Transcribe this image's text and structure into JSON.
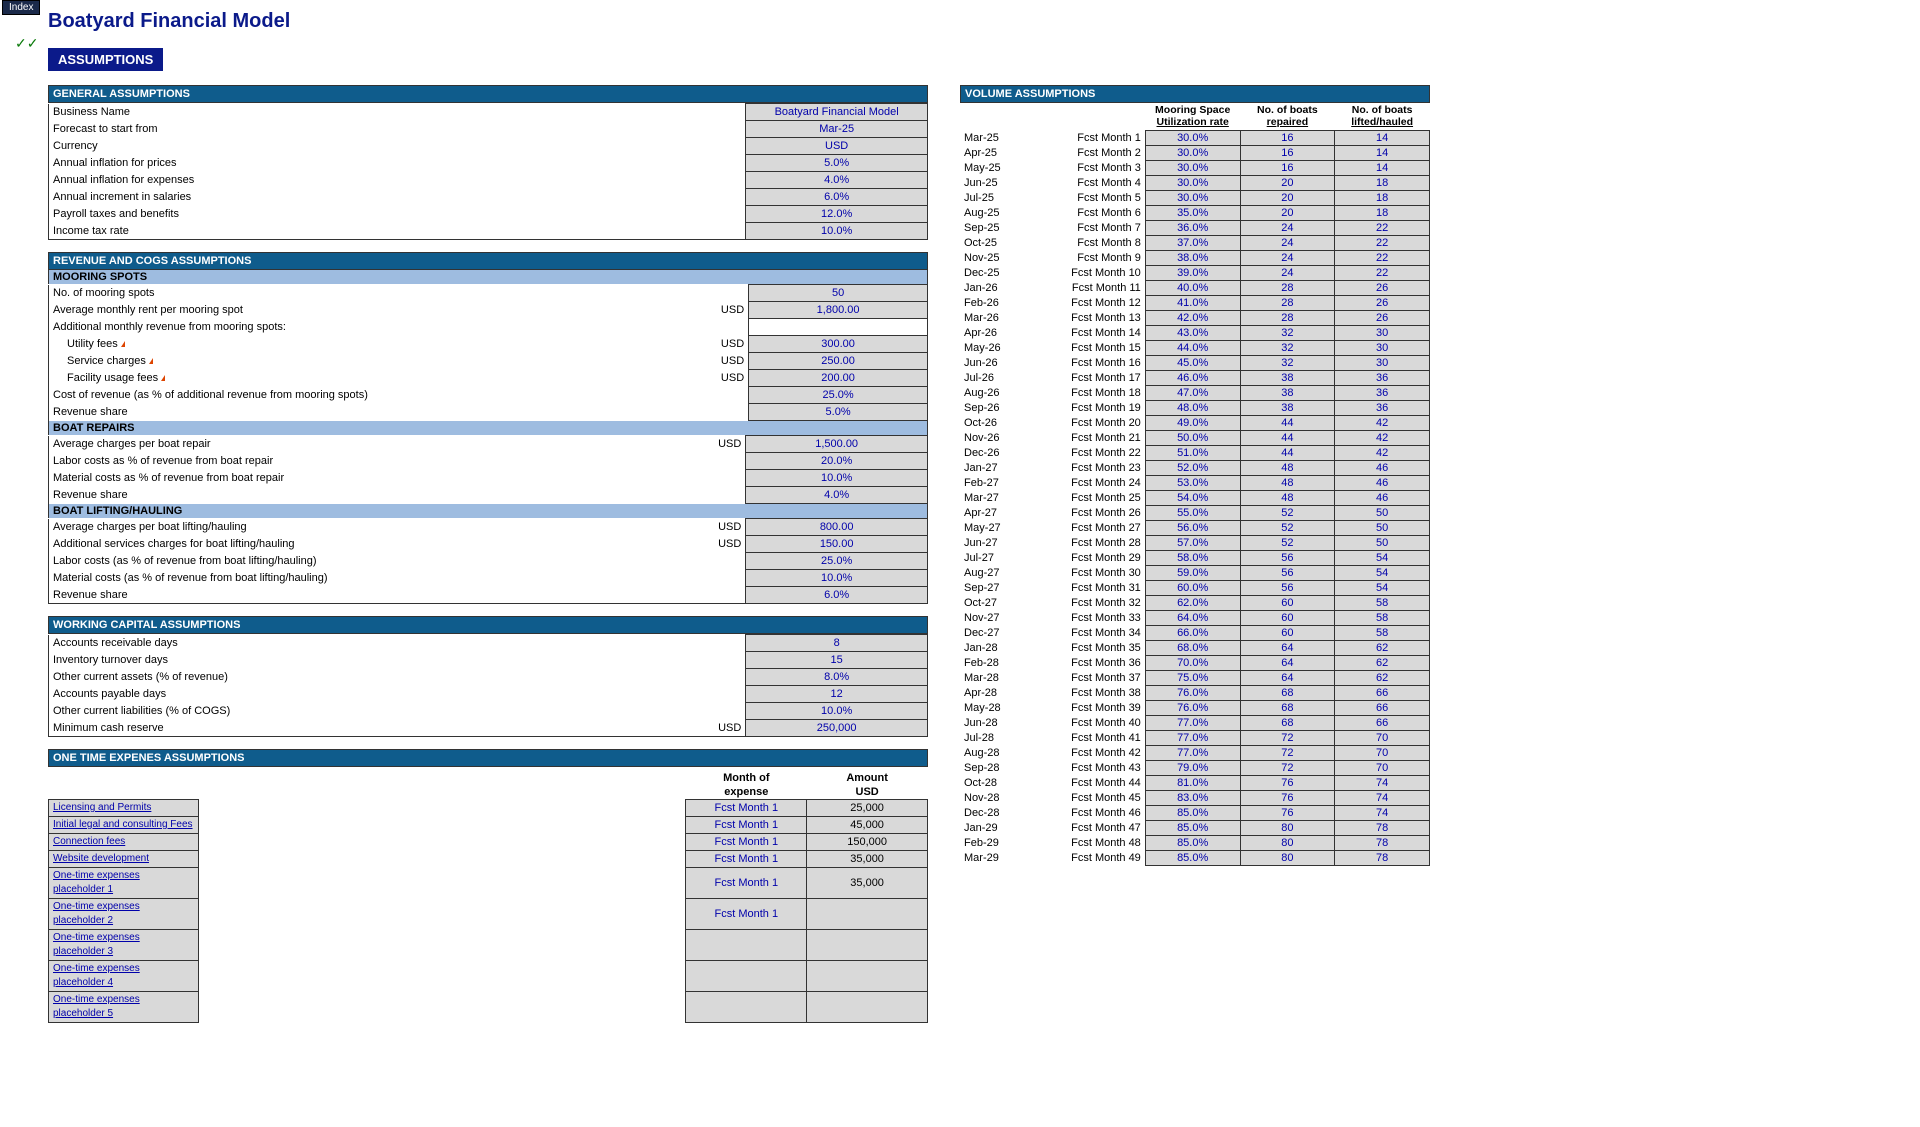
{
  "ui": {
    "index_tab": "Index",
    "title": "Boatyard Financial Model",
    "assumptions_badge": "ASSUMPTIONS",
    "checkmarks": "✓✓"
  },
  "sections": {
    "general": "GENERAL ASSUMPTIONS",
    "revcogs": "REVENUE AND COGS ASSUMPTIONS",
    "mooring": "MOORING SPOTS",
    "repairs": "BOAT REPAIRS",
    "lifting": "BOAT LIFTING/HAULING",
    "wc": "WORKING CAPITAL ASSUMPTIONS",
    "ote": "ONE TIME EXPENES ASSUMPTIONS",
    "volume": "VOLUME ASSUMPTIONS"
  },
  "labels": {
    "business_name": "Business Name",
    "forecast_start": "Forecast to start from",
    "currency": "Currency",
    "infl_prices": "Annual inflation for prices",
    "infl_expenses": "Annual inflation for expenses",
    "incr_salaries": "Annual increment in salaries",
    "payroll_tax": "Payroll taxes and benefits",
    "income_tax": "Income tax rate",
    "no_mooring": "No. of mooring spots",
    "avg_rent": "Average monthly rent per mooring spot",
    "addl_rev": "Additional monthly revenue from mooring spots:",
    "utility": "Utility fees",
    "service": "Service charges",
    "facility": "Facility usage fees",
    "cost_rev_pct": "Cost of revenue (as % of additional revenue from mooring spots)",
    "rev_share": "Revenue share",
    "avg_repair": "Average charges per boat repair",
    "labor_repair": "Labor costs as % of revenue from boat repair",
    "mat_repair": "Material costs as % of revenue from boat repair",
    "avg_lift": "Average charges per boat lifting/hauling",
    "addl_lift": "Additional services charges for boat lifting/hauling",
    "labor_lift": "Labor costs (as % of revenue from boat lifting/hauling)",
    "mat_lift": "Material costs (as % of revenue from boat lifting/hauling)",
    "ar_days": "Accounts receivable days",
    "inv_days": "Inventory turnover days",
    "oca_pct": "Other current assets (% of revenue)",
    "ap_days": "Accounts payable days",
    "ocl_pct": "Other current liabilities (% of COGS)",
    "min_cash": "Minimum cash reserve",
    "ote_month_hdr1": "Month of",
    "ote_month_hdr2": "expense",
    "ote_amt_hdr1": "Amount",
    "ote_amt_hdr2": "USD",
    "vol_h1a": "Mooring Space",
    "vol_h1b": "Utilization rate",
    "vol_h2a": "No. of boats",
    "vol_h2b": "repaired",
    "vol_h3a": "No. of boats",
    "vol_h3b": "lifted/hauled"
  },
  "usd": "USD",
  "general": {
    "business_name": "Boatyard Financial Model",
    "forecast_start": "Mar-25",
    "currency": "USD",
    "infl_prices": "5.0%",
    "infl_expenses": "4.0%",
    "incr_salaries": "6.0%",
    "payroll_tax": "12.0%",
    "income_tax": "10.0%"
  },
  "mooring": {
    "no_spots": "50",
    "avg_rent": "1,800.00",
    "utility": "300.00",
    "service": "250.00",
    "facility": "200.00",
    "cost_rev_pct": "25.0%",
    "rev_share": "5.0%"
  },
  "repairs": {
    "avg_charge": "1,500.00",
    "labor_pct": "20.0%",
    "mat_pct": "10.0%",
    "rev_share": "4.0%"
  },
  "lifting": {
    "avg_charge": "800.00",
    "addl_charge": "150.00",
    "labor_pct": "25.0%",
    "mat_pct": "10.0%",
    "rev_share": "6.0%"
  },
  "wc": {
    "ar_days": "8",
    "inv_days": "15",
    "oca_pct": "8.0%",
    "ap_days": "12",
    "ocl_pct": "10.0%",
    "min_cash": "250,000"
  },
  "ote": [
    {
      "name": "Licensing and Permits",
      "month": "Fcst Month 1",
      "amt": "25,000"
    },
    {
      "name": "Initial legal and consulting Fees",
      "month": "Fcst Month 1",
      "amt": "45,000"
    },
    {
      "name": "Connection fees",
      "month": "Fcst Month 1",
      "amt": "150,000"
    },
    {
      "name": "Website development",
      "month": "Fcst Month 1",
      "amt": "35,000"
    },
    {
      "name": "One-time expenses placeholder 1",
      "month": "Fcst Month 1",
      "amt": "35,000"
    },
    {
      "name": "One-time expenses placeholder 2",
      "month": "Fcst Month 1",
      "amt": ""
    },
    {
      "name": "One-time expenses placeholder 3",
      "month": "",
      "amt": ""
    },
    {
      "name": "One-time expenses placeholder 4",
      "month": "",
      "amt": ""
    },
    {
      "name": "One-time expenses placeholder 5",
      "month": "",
      "amt": ""
    }
  ],
  "volume": [
    {
      "m": "Mar-25",
      "n": "Fcst Month 1",
      "u": "30.0%",
      "r": "16",
      "l": "14"
    },
    {
      "m": "Apr-25",
      "n": "Fcst Month 2",
      "u": "30.0%",
      "r": "16",
      "l": "14"
    },
    {
      "m": "May-25",
      "n": "Fcst Month 3",
      "u": "30.0%",
      "r": "16",
      "l": "14"
    },
    {
      "m": "Jun-25",
      "n": "Fcst Month 4",
      "u": "30.0%",
      "r": "20",
      "l": "18"
    },
    {
      "m": "Jul-25",
      "n": "Fcst Month 5",
      "u": "30.0%",
      "r": "20",
      "l": "18"
    },
    {
      "m": "Aug-25",
      "n": "Fcst Month 6",
      "u": "35.0%",
      "r": "20",
      "l": "18"
    },
    {
      "m": "Sep-25",
      "n": "Fcst Month 7",
      "u": "36.0%",
      "r": "24",
      "l": "22"
    },
    {
      "m": "Oct-25",
      "n": "Fcst Month 8",
      "u": "37.0%",
      "r": "24",
      "l": "22"
    },
    {
      "m": "Nov-25",
      "n": "Fcst Month 9",
      "u": "38.0%",
      "r": "24",
      "l": "22"
    },
    {
      "m": "Dec-25",
      "n": "Fcst Month 10",
      "u": "39.0%",
      "r": "24",
      "l": "22"
    },
    {
      "m": "Jan-26",
      "n": "Fcst Month 11",
      "u": "40.0%",
      "r": "28",
      "l": "26"
    },
    {
      "m": "Feb-26",
      "n": "Fcst Month 12",
      "u": "41.0%",
      "r": "28",
      "l": "26"
    },
    {
      "m": "Mar-26",
      "n": "Fcst Month 13",
      "u": "42.0%",
      "r": "28",
      "l": "26"
    },
    {
      "m": "Apr-26",
      "n": "Fcst Month 14",
      "u": "43.0%",
      "r": "32",
      "l": "30"
    },
    {
      "m": "May-26",
      "n": "Fcst Month 15",
      "u": "44.0%",
      "r": "32",
      "l": "30"
    },
    {
      "m": "Jun-26",
      "n": "Fcst Month 16",
      "u": "45.0%",
      "r": "32",
      "l": "30"
    },
    {
      "m": "Jul-26",
      "n": "Fcst Month 17",
      "u": "46.0%",
      "r": "38",
      "l": "36"
    },
    {
      "m": "Aug-26",
      "n": "Fcst Month 18",
      "u": "47.0%",
      "r": "38",
      "l": "36"
    },
    {
      "m": "Sep-26",
      "n": "Fcst Month 19",
      "u": "48.0%",
      "r": "38",
      "l": "36"
    },
    {
      "m": "Oct-26",
      "n": "Fcst Month 20",
      "u": "49.0%",
      "r": "44",
      "l": "42"
    },
    {
      "m": "Nov-26",
      "n": "Fcst Month 21",
      "u": "50.0%",
      "r": "44",
      "l": "42"
    },
    {
      "m": "Dec-26",
      "n": "Fcst Month 22",
      "u": "51.0%",
      "r": "44",
      "l": "42"
    },
    {
      "m": "Jan-27",
      "n": "Fcst Month 23",
      "u": "52.0%",
      "r": "48",
      "l": "46"
    },
    {
      "m": "Feb-27",
      "n": "Fcst Month 24",
      "u": "53.0%",
      "r": "48",
      "l": "46"
    },
    {
      "m": "Mar-27",
      "n": "Fcst Month 25",
      "u": "54.0%",
      "r": "48",
      "l": "46"
    },
    {
      "m": "Apr-27",
      "n": "Fcst Month 26",
      "u": "55.0%",
      "r": "52",
      "l": "50"
    },
    {
      "m": "May-27",
      "n": "Fcst Month 27",
      "u": "56.0%",
      "r": "52",
      "l": "50"
    },
    {
      "m": "Jun-27",
      "n": "Fcst Month 28",
      "u": "57.0%",
      "r": "52",
      "l": "50"
    },
    {
      "m": "Jul-27",
      "n": "Fcst Month 29",
      "u": "58.0%",
      "r": "56",
      "l": "54"
    },
    {
      "m": "Aug-27",
      "n": "Fcst Month 30",
      "u": "59.0%",
      "r": "56",
      "l": "54"
    },
    {
      "m": "Sep-27",
      "n": "Fcst Month 31",
      "u": "60.0%",
      "r": "56",
      "l": "54"
    },
    {
      "m": "Oct-27",
      "n": "Fcst Month 32",
      "u": "62.0%",
      "r": "60",
      "l": "58"
    },
    {
      "m": "Nov-27",
      "n": "Fcst Month 33",
      "u": "64.0%",
      "r": "60",
      "l": "58"
    },
    {
      "m": "Dec-27",
      "n": "Fcst Month 34",
      "u": "66.0%",
      "r": "60",
      "l": "58"
    },
    {
      "m": "Jan-28",
      "n": "Fcst Month 35",
      "u": "68.0%",
      "r": "64",
      "l": "62"
    },
    {
      "m": "Feb-28",
      "n": "Fcst Month 36",
      "u": "70.0%",
      "r": "64",
      "l": "62"
    },
    {
      "m": "Mar-28",
      "n": "Fcst Month 37",
      "u": "75.0%",
      "r": "64",
      "l": "62"
    },
    {
      "m": "Apr-28",
      "n": "Fcst Month 38",
      "u": "76.0%",
      "r": "68",
      "l": "66"
    },
    {
      "m": "May-28",
      "n": "Fcst Month 39",
      "u": "76.0%",
      "r": "68",
      "l": "66"
    },
    {
      "m": "Jun-28",
      "n": "Fcst Month 40",
      "u": "77.0%",
      "r": "68",
      "l": "66"
    },
    {
      "m": "Jul-28",
      "n": "Fcst Month 41",
      "u": "77.0%",
      "r": "72",
      "l": "70"
    },
    {
      "m": "Aug-28",
      "n": "Fcst Month 42",
      "u": "77.0%",
      "r": "72",
      "l": "70"
    },
    {
      "m": "Sep-28",
      "n": "Fcst Month 43",
      "u": "79.0%",
      "r": "72",
      "l": "70"
    },
    {
      "m": "Oct-28",
      "n": "Fcst Month 44",
      "u": "81.0%",
      "r": "76",
      "l": "74"
    },
    {
      "m": "Nov-28",
      "n": "Fcst Month 45",
      "u": "83.0%",
      "r": "76",
      "l": "74"
    },
    {
      "m": "Dec-28",
      "n": "Fcst Month 46",
      "u": "85.0%",
      "r": "76",
      "l": "74"
    },
    {
      "m": "Jan-29",
      "n": "Fcst Month 47",
      "u": "85.0%",
      "r": "80",
      "l": "78"
    },
    {
      "m": "Feb-29",
      "n": "Fcst Month 48",
      "u": "85.0%",
      "r": "80",
      "l": "78"
    },
    {
      "m": "Mar-29",
      "n": "Fcst Month 49",
      "u": "85.0%",
      "r": "80",
      "l": "78"
    }
  ]
}
